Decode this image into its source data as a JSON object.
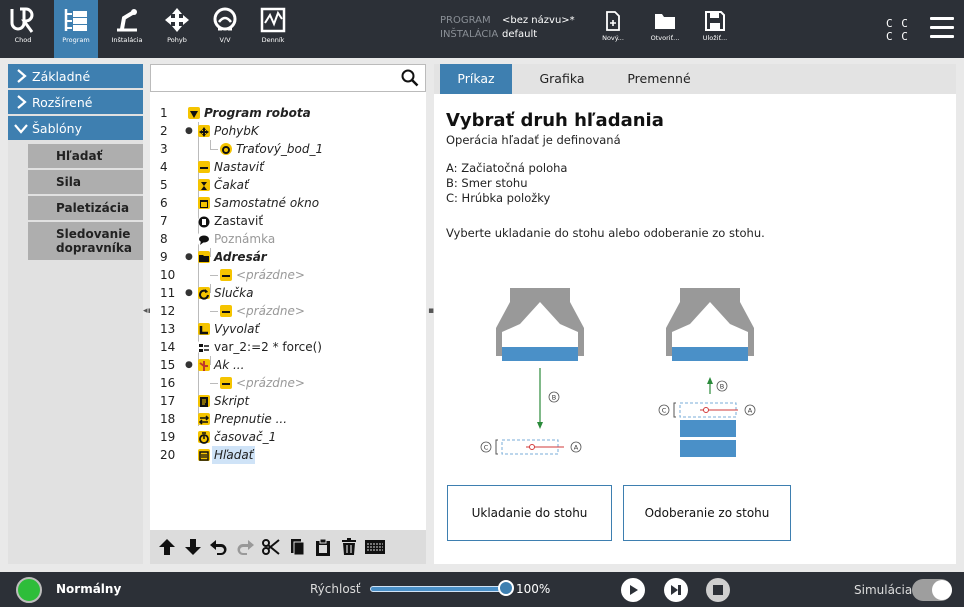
{
  "topbar": {
    "nav": [
      {
        "label": "Chod",
        "icon": "ur-logo-icon"
      },
      {
        "label": "Program",
        "icon": "program-icon"
      },
      {
        "label": "Inštalácia",
        "icon": "installation-icon"
      },
      {
        "label": "Pohyb",
        "icon": "move-icon"
      },
      {
        "label": "V/V",
        "icon": "io-icon"
      },
      {
        "label": "Denník",
        "icon": "log-icon"
      }
    ],
    "program_key": "PROGRAM",
    "program_value": "<bez názvu>*",
    "installation_key": "INŠTALÁCIA",
    "installation_value": "default",
    "file_buttons": [
      {
        "label": "Nový...",
        "icon": "new-file-icon"
      },
      {
        "label": "Otvoriť...",
        "icon": "open-folder-icon"
      },
      {
        "label": "Uložiť...",
        "icon": "save-icon"
      }
    ],
    "cc_line1": "C C",
    "cc_line2": "C C"
  },
  "leftnav": {
    "sections": [
      {
        "label": "Základné",
        "expanded": false
      },
      {
        "label": "Rozšírené",
        "expanded": false
      },
      {
        "label": "Šablóny",
        "expanded": true
      }
    ],
    "templates": [
      "Hľadať",
      "Sila",
      "Paletizácia",
      "Sledovanie dopravníka"
    ]
  },
  "tree": {
    "search_placeholder": "",
    "rows": [
      {
        "num": "1",
        "label": "Program robota"
      },
      {
        "num": "2",
        "label": "PohybK"
      },
      {
        "num": "3",
        "label": "Traťový_bod_1"
      },
      {
        "num": "4",
        "label": "Nastaviť"
      },
      {
        "num": "5",
        "label": "Čakať"
      },
      {
        "num": "6",
        "label": "Samostatné okno"
      },
      {
        "num": "7",
        "label": "Zastaviť"
      },
      {
        "num": "8",
        "label": "Poznámka"
      },
      {
        "num": "9",
        "label": "Adresár"
      },
      {
        "num": "10",
        "label": "<prázdne>"
      },
      {
        "num": "11",
        "label": "Slučka"
      },
      {
        "num": "12",
        "label": "<prázdne>"
      },
      {
        "num": "13",
        "label": "Vyvolať"
      },
      {
        "num": "14",
        "label": "var_2:=2 * force()"
      },
      {
        "num": "15",
        "label": "Ak ..."
      },
      {
        "num": "16",
        "label": "<prázdne>"
      },
      {
        "num": "17",
        "label": "Skript"
      },
      {
        "num": "18",
        "label": "Prepnutie ..."
      },
      {
        "num": "19",
        "label": "časovač_1"
      },
      {
        "num": "20",
        "label": "Hľadať"
      }
    ],
    "toolbar_icons": [
      "move-up-icon",
      "move-down-icon",
      "undo-icon",
      "redo-icon",
      "cut-icon",
      "copy-icon",
      "paste-icon",
      "delete-icon",
      "suppress-icon"
    ]
  },
  "right": {
    "tabs": [
      "Príkaz",
      "Grafika",
      "Premenné"
    ],
    "active_tab": "Príkaz",
    "heading": "Vybrať druh hľadania",
    "subheading": "Operácia hľadať je definovaná",
    "definitions": [
      "A: Začiatočná poloha",
      "B: Smer stohu",
      "C: Hrúbka položky"
    ],
    "instruction": "Vyberte ukladanie do stohu alebo odoberanie zo stohu.",
    "diagram_labels": {
      "a": "A",
      "b": "B",
      "c": "C"
    },
    "buttons": [
      "Ukladanie do stohu",
      "Odoberanie zo stohu"
    ]
  },
  "bottombar": {
    "status": "Normálny",
    "status_color": "#2ebd3a",
    "speed_label": "Rýchlosť",
    "speed_value": "100%",
    "speed_fraction": 1.0,
    "simulation_label": "Simulácia",
    "simulation_on": false
  },
  "colors": {
    "accent": "#3e7fb0",
    "topbar": "#2c3037",
    "stack_blue": "#4a90c8",
    "green_arrow": "#2a8a3a",
    "red_marker": "#d23a3a"
  }
}
